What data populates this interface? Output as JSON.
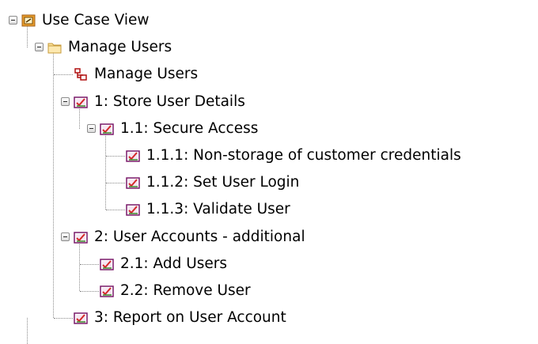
{
  "tree": {
    "nodes": [
      {
        "id": "root",
        "depth": 0,
        "label": "Use Case View",
        "icon": "package-view-icon",
        "expanded": true,
        "has_children": true
      },
      {
        "id": "manage-users-folder",
        "depth": 1,
        "label": "Manage Users",
        "icon": "folder-icon",
        "expanded": true,
        "has_children": true
      },
      {
        "id": "manage-users-diagram",
        "depth": 2,
        "label": "Manage Users",
        "icon": "diagram-icon",
        "has_children": false
      },
      {
        "id": "req-1",
        "depth": 2,
        "label": "1: Store User Details",
        "icon": "requirement-icon",
        "expanded": true,
        "has_children": true
      },
      {
        "id": "req-1-1",
        "depth": 3,
        "label": "1.1: Secure Access",
        "icon": "requirement-icon",
        "expanded": true,
        "has_children": true
      },
      {
        "id": "req-1-1-1",
        "depth": 4,
        "label": "1.1.1: Non-storage of customer credentials",
        "icon": "requirement-icon",
        "has_children": false
      },
      {
        "id": "req-1-1-2",
        "depth": 4,
        "label": "1.1.2: Set User Login",
        "icon": "requirement-icon",
        "has_children": false
      },
      {
        "id": "req-1-1-3",
        "depth": 4,
        "label": "1.1.3: Validate User",
        "icon": "requirement-icon",
        "has_children": false
      },
      {
        "id": "req-2",
        "depth": 2,
        "label": "2: User Accounts - additional",
        "icon": "requirement-icon",
        "expanded": true,
        "has_children": true
      },
      {
        "id": "req-2-1",
        "depth": 3,
        "label": "2.1: Add Users",
        "icon": "requirement-icon",
        "has_children": false
      },
      {
        "id": "req-2-2",
        "depth": 3,
        "label": "2.2: Remove User",
        "icon": "requirement-icon",
        "has_children": false
      },
      {
        "id": "req-3",
        "depth": 2,
        "label": "3: Report on User Account",
        "icon": "requirement-icon",
        "has_children": false
      }
    ]
  },
  "colors": {
    "tree_line": "#8a8a8a",
    "folder_fill": "#fbe29a",
    "requirement_red": "#d42a2a",
    "requirement_green": "#3a8a2a",
    "package_orange": "#e89c2a"
  }
}
